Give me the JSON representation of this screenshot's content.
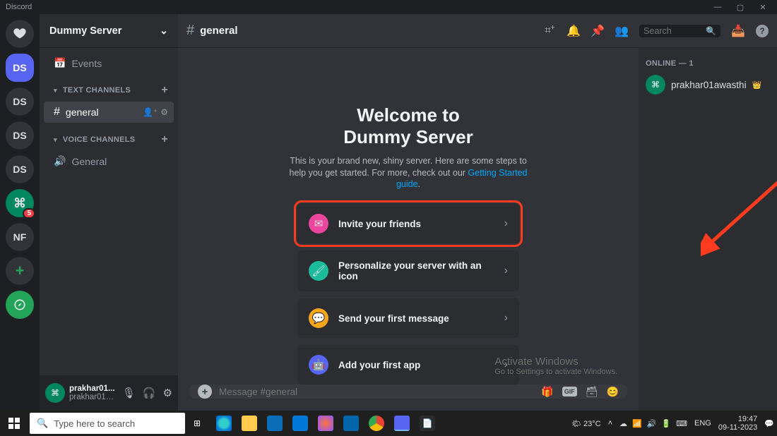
{
  "titlebar": {
    "app": "Discord"
  },
  "server": {
    "name": "Dummy Server"
  },
  "guilds": {
    "g1": "DS",
    "g2": "DS",
    "g3": "DS",
    "g4": "DS",
    "gfg": "⌘",
    "nf": "NF",
    "badge": "5"
  },
  "sidebar": {
    "events": "Events",
    "text_cat": "Text Channels",
    "voice_cat": "Voice Channels",
    "general": "general",
    "voice_general": "General"
  },
  "user": {
    "name": "prakhar01...",
    "tag": "prakhar01aw..."
  },
  "header": {
    "channel": "general",
    "search_placeholder": "Search"
  },
  "welcome": {
    "line1": "Welcome to",
    "line2": "Dummy Server",
    "desc_a": "This is your brand new, shiny server. Here are some steps to help you get started. For more, check out our ",
    "link": "Getting Started guide",
    "card1": "Invite your friends",
    "card2": "Personalize your server with an icon",
    "card3": "Send your first message",
    "card4": "Add your first app"
  },
  "message": {
    "placeholder": "Message #general",
    "gif": "GIF"
  },
  "members": {
    "header": "Online — 1",
    "m1": "prakhar01awasthi"
  },
  "activate": {
    "t1": "Activate Windows",
    "t2": "Go to Settings to activate Windows."
  },
  "taskbar": {
    "search": "Type here to search",
    "weather": "🌤 23°C",
    "lang": "ENG",
    "time": "19:47",
    "date": "09-11-2023"
  }
}
